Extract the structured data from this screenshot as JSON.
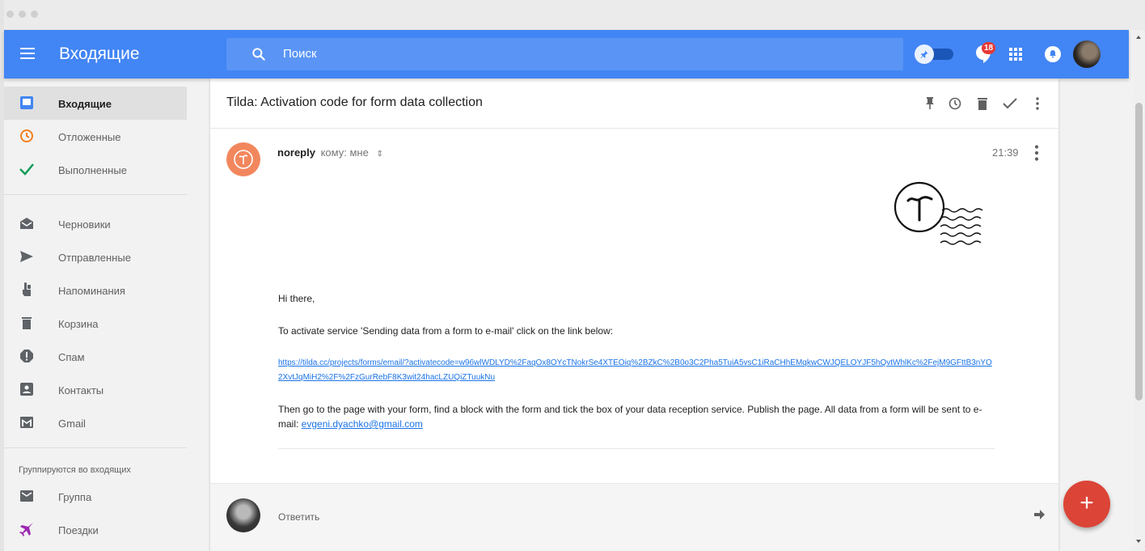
{
  "app": {
    "title": "Входящие",
    "search_placeholder": "Поиск",
    "notification_count": "18",
    "accent_color": "#4285f4"
  },
  "sidebar": {
    "items": [
      {
        "label": "Входящие",
        "icon": "inbox-icon",
        "active": true
      },
      {
        "label": "Отложенные",
        "icon": "clock-icon"
      },
      {
        "label": "Выполненные",
        "icon": "check-icon"
      },
      {
        "label": "Черновики",
        "icon": "drafts-icon"
      },
      {
        "label": "Отправленные",
        "icon": "send-icon"
      },
      {
        "label": "Напоминания",
        "icon": "reminder-icon"
      },
      {
        "label": "Корзина",
        "icon": "trash-icon"
      },
      {
        "label": "Спам",
        "icon": "spam-icon"
      },
      {
        "label": "Контакты",
        "icon": "contacts-icon"
      },
      {
        "label": "Gmail",
        "icon": "gmail-icon"
      }
    ],
    "group_title": "Группируются во входящих",
    "group_items": [
      {
        "label": "Группа",
        "icon": "group-icon"
      },
      {
        "label": "Поездки",
        "icon": "flight-icon"
      }
    ]
  },
  "email": {
    "subject": "Tilda: Activation code for form data collection",
    "sender": "noreply",
    "to": "кому: мне",
    "time": "21:39",
    "greeting": "Hi there,",
    "instruction": "To activate service 'Sending data from a form to e-mail' click on the link below:",
    "link": "https://tilda.cc/projects/forms/email/?activatecode=w96wlWDLYD%2FaqOx8OYcTNokrSe4XTEOiq%2BZkC%2B0o3C2Pha5TuiA5vsC1iRaCHhEMqkwCWJQELOYJF5hQvtWhlKc%2FejM9GFttB3nYO2XvtJqMiH2%2F%2FzGurRebF8K3wit24hacLZUQiZTuukNu",
    "closing_text": "Then go to the page with your form, find a block with the form and tick the box of your data reception service. Publish the page. All data from a form will be sent to e-mail: ",
    "recipient_email": "evgeni.dyachko@gmail.com"
  },
  "reply": {
    "label": "Ответить"
  },
  "compose": {
    "label": "+"
  }
}
